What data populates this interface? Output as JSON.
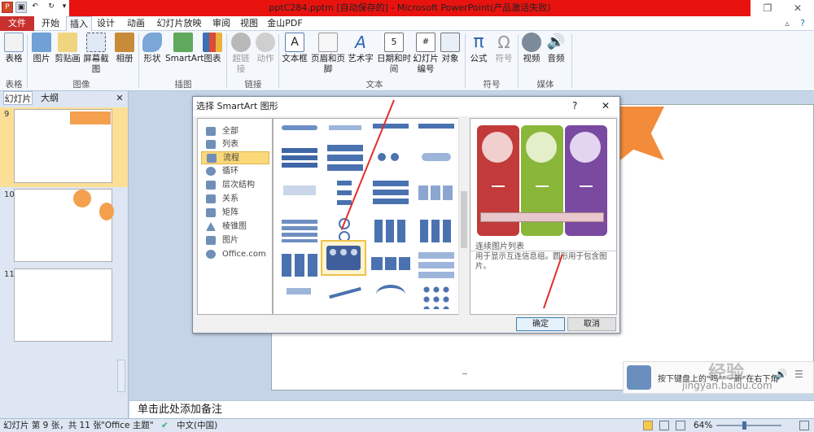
{
  "window": {
    "title": "pptC284.pptm [自动保存的] - Microsoft PowerPoint(产品激活失败)"
  },
  "tabs": [
    "文件",
    "开始",
    "插入",
    "设计",
    "动画",
    "幻灯片放映",
    "审阅",
    "视图",
    "金山PDF"
  ],
  "ribbon": {
    "buttons": [
      "表格",
      "图片",
      "剪贴画",
      "屏幕截图",
      "相册",
      "形状",
      "SmartArt",
      "图表",
      "超链接",
      "动作",
      "文本框",
      "页眉和页脚",
      "艺术字",
      "日期和时间",
      "幻灯片编号",
      "对象",
      "公式",
      "符号",
      "视频",
      "音频"
    ],
    "groups": [
      "表格",
      "图像",
      "插图",
      "链接",
      "文本",
      "符号",
      "媒体"
    ]
  },
  "panel": {
    "tabs": [
      "幻灯片",
      "大纲"
    ],
    "slides": [
      "9",
      "10",
      "11"
    ]
  },
  "dialog": {
    "title": "选择 SmartArt 图形",
    "help": "?",
    "close": "✕",
    "categories": [
      "全部",
      "列表",
      "流程",
      "循环",
      "层次结构",
      "关系",
      "矩阵",
      "棱锥图",
      "图片",
      "Office.com"
    ],
    "selected_category": "流程",
    "preview_title": "连续图片列表",
    "preview_desc": "用于显示互连信息组。圆形用于包含图片。",
    "ok": "确定",
    "cancel": "取消"
  },
  "notes": {
    "placeholder": "单击此处添加备注"
  },
  "status": {
    "slide_info": "幻灯片 第 9 张，共 11 张",
    "theme": "\"Office 主题\"",
    "language": "中文(中国)",
    "zoom": "64%"
  },
  "colors": {
    "title_red": "#e8130f",
    "file_tab": "#c8302d",
    "selected": "#fbd879",
    "preview_red": "#c23a3a",
    "preview_green": "#8ab63a",
    "preview_purple": "#7a4aa0"
  },
  "overlay": {
    "text": "按下键盘上的\"鸣\"\"一新\"在右下角",
    "watermark": "经验",
    "site": "jingyan.baidu.com"
  }
}
